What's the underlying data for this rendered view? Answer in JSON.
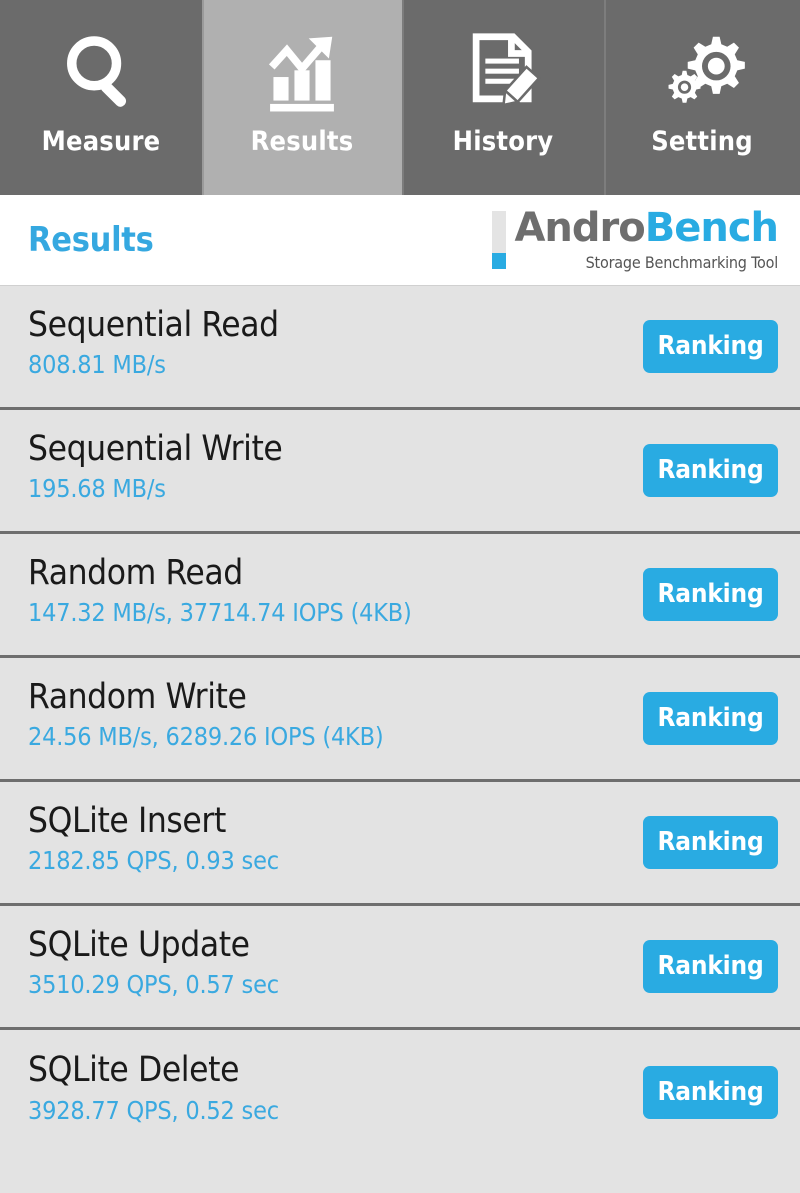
{
  "tabs": [
    {
      "label": "Measure",
      "icon": "magnifier-icon",
      "active": false
    },
    {
      "label": "Results",
      "icon": "bar-chart-arrow-icon",
      "active": true
    },
    {
      "label": "History",
      "icon": "document-pencil-icon",
      "active": false
    },
    {
      "label": "Setting",
      "icon": "gears-icon",
      "active": false
    }
  ],
  "header": {
    "title": "Results",
    "logo": {
      "primary": "Andro",
      "secondary": "Bench",
      "subtitle": "Storage Benchmarking Tool"
    }
  },
  "colors": {
    "accent_blue": "#29abe2",
    "value_blue": "#3aa9e0",
    "tab_inactive": "#6b6b6b",
    "tab_active": "#b0b0b0",
    "row_bg": "#e3e3e3",
    "row_divider": "#6e6e6e",
    "title_text": "#1a1a1a",
    "logo_gray": "#6e6e6e"
  },
  "results": [
    {
      "title": "Sequential Read",
      "value": "808.81 MB/s",
      "ranking_label": "Ranking"
    },
    {
      "title": "Sequential Write",
      "value": "195.68 MB/s",
      "ranking_label": "Ranking"
    },
    {
      "title": "Random Read",
      "value": "147.32 MB/s, 37714.74 IOPS (4KB)",
      "ranking_label": "Ranking"
    },
    {
      "title": "Random Write",
      "value": "24.56 MB/s, 6289.26 IOPS (4KB)",
      "ranking_label": "Ranking"
    },
    {
      "title": "SQLite Insert",
      "value": "2182.85 QPS, 0.93 sec",
      "ranking_label": "Ranking"
    },
    {
      "title": "SQLite Update",
      "value": "3510.29 QPS, 0.57 sec",
      "ranking_label": "Ranking"
    },
    {
      "title": "SQLite Delete",
      "value": "3928.77 QPS, 0.52 sec",
      "ranking_label": "Ranking"
    }
  ]
}
